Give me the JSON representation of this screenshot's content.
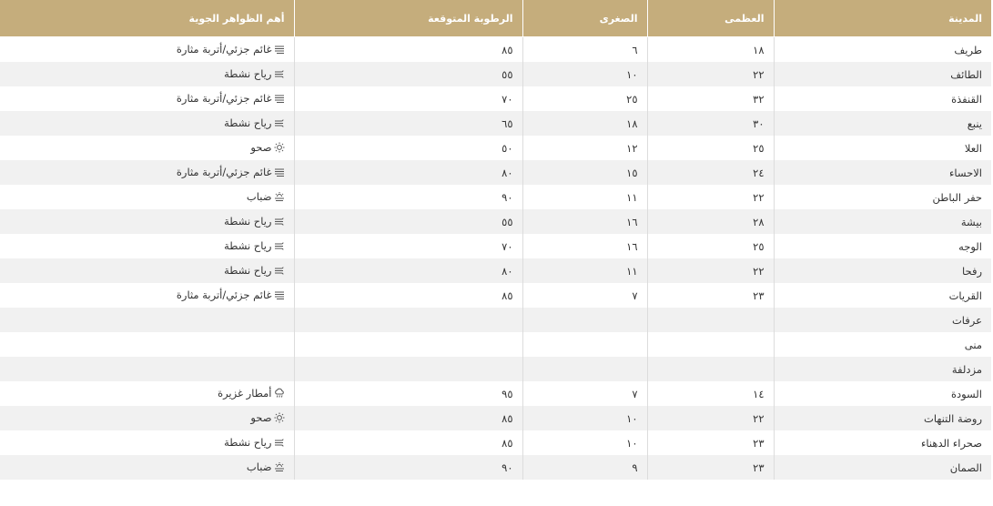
{
  "headers": {
    "city": "المدينة",
    "max": "العظمى",
    "min": "الصغرى",
    "humidity": "الرطوبة المتوقعة",
    "phenomena": "أهم الظواهر الجوية"
  },
  "rows": [
    {
      "city": "طريف",
      "max": "١٨",
      "min": "٦",
      "humidity": "٨٥",
      "phenomenon": "غائم جزئي/أتربة مثارة",
      "icon": "dust-icon"
    },
    {
      "city": "الطائف",
      "max": "٢٢",
      "min": "١٠",
      "humidity": "٥٥",
      "phenomenon": "رياح نشطة",
      "icon": "wind-icon"
    },
    {
      "city": "القنفذة",
      "max": "٣٢",
      "min": "٢٥",
      "humidity": "٧٠",
      "phenomenon": "غائم جزئي/أتربة مثارة",
      "icon": "dust-icon"
    },
    {
      "city": "ينبع",
      "max": "٣٠",
      "min": "١٨",
      "humidity": "٦٥",
      "phenomenon": "رياح نشطة",
      "icon": "wind-icon"
    },
    {
      "city": "العلا",
      "max": "٢٥",
      "min": "١٢",
      "humidity": "٥٠",
      "phenomenon": "صحو",
      "icon": "sun-icon"
    },
    {
      "city": "الاحساء",
      "max": "٢٤",
      "min": "١٥",
      "humidity": "٨٠",
      "phenomenon": "غائم جزئي/أتربة مثارة",
      "icon": "dust-icon"
    },
    {
      "city": "حفر الباطن",
      "max": "٢٢",
      "min": "١١",
      "humidity": "٩٠",
      "phenomenon": "ضباب",
      "icon": "fog-icon"
    },
    {
      "city": "بيشة",
      "max": "٢٨",
      "min": "١٦",
      "humidity": "٥٥",
      "phenomenon": "رياح نشطة",
      "icon": "wind-icon"
    },
    {
      "city": "الوجه",
      "max": "٢٥",
      "min": "١٦",
      "humidity": "٧٠",
      "phenomenon": "رياح نشطة",
      "icon": "wind-icon"
    },
    {
      "city": "رفحا",
      "max": "٢٢",
      "min": "١١",
      "humidity": "٨٠",
      "phenomenon": "رياح نشطة",
      "icon": "wind-icon"
    },
    {
      "city": "القريات",
      "max": "٢٣",
      "min": "٧",
      "humidity": "٨٥",
      "phenomenon": "غائم جزئي/أتربة مثارة",
      "icon": "dust-icon"
    },
    {
      "city": "عرفات",
      "max": "",
      "min": "",
      "humidity": "",
      "phenomenon": "",
      "icon": ""
    },
    {
      "city": "منى",
      "max": "",
      "min": "",
      "humidity": "",
      "phenomenon": "",
      "icon": ""
    },
    {
      "city": "مزدلفة",
      "max": "",
      "min": "",
      "humidity": "",
      "phenomenon": "",
      "icon": ""
    },
    {
      "city": "السودة",
      "max": "١٤",
      "min": "٧",
      "humidity": "٩٥",
      "phenomenon": "أمطار غزيرة",
      "icon": "rain-icon"
    },
    {
      "city": "روضة التنهات",
      "max": "٢٢",
      "min": "١٠",
      "humidity": "٨٥",
      "phenomenon": "صحو",
      "icon": "sun-icon"
    },
    {
      "city": "صحراء الدهناء",
      "max": "٢٣",
      "min": "١٠",
      "humidity": "٨٥",
      "phenomenon": "رياح نشطة",
      "icon": "wind-icon"
    },
    {
      "city": "الصمان",
      "max": "٢٣",
      "min": "٩",
      "humidity": "٩٠",
      "phenomenon": "ضباب",
      "icon": "fog-icon"
    }
  ],
  "colors": {
    "header_bg": "#c5ad7c",
    "header_text": "#ffffff",
    "row_alt": "#f1f1f1",
    "text": "#333333",
    "icon": "#555555"
  }
}
